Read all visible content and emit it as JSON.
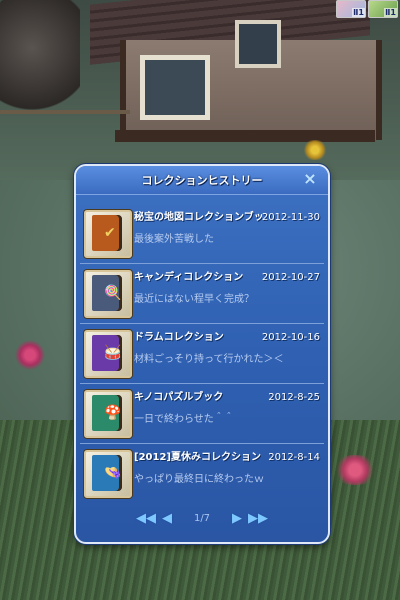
{
  "status": {
    "tile1_label": "Ⅱ1",
    "tile2_label": "Ⅱ1"
  },
  "panel": {
    "title": "コレクションヒストリー",
    "close_icon": "×",
    "rows": [
      {
        "title": "秘宝の地図コレクションブック",
        "date": "2012-11-30",
        "comment": "最後案外苦戦した",
        "icon": "treasure-map-book-icon",
        "color": "#b85a1e",
        "symbol": "✔"
      },
      {
        "title": "キャンディコレクション",
        "date": "2012-10-27",
        "comment": "最近にはない程早く完成？",
        "icon": "candy-book-icon",
        "color": "#4a5a7a",
        "symbol": "🍭"
      },
      {
        "title": "ドラムコレクション",
        "date": "2012-10-16",
        "comment": "材料ごっそり持って行かれた＞＜",
        "icon": "drum-book-icon",
        "color": "#6a3aa8",
        "symbol": "🥁"
      },
      {
        "title": "キノコパズルブック",
        "date": "2012-8-25",
        "comment": "一日で終わらせた＾＾",
        "icon": "mushroom-book-icon",
        "color": "#2a8a6a",
        "symbol": "🍄"
      },
      {
        "title": "[2012]夏休みコレクション",
        "date": "2012-8-14",
        "comment": "やっぱり最終日に終わったｗ",
        "icon": "summer-hat-book-icon",
        "color": "#2a7ab8",
        "symbol": "👒"
      }
    ],
    "pager": {
      "first": "◀◀",
      "prev": "◀",
      "page_text": "1/7",
      "next": "▶",
      "last": "▶▶"
    }
  },
  "colors": {
    "panel_bg": "#2f60b2",
    "panel_border": "#dfe8f6",
    "title_text": "#ffffff",
    "comment_text": "#b7ccf0",
    "pager_button": "#7ec8ff"
  }
}
